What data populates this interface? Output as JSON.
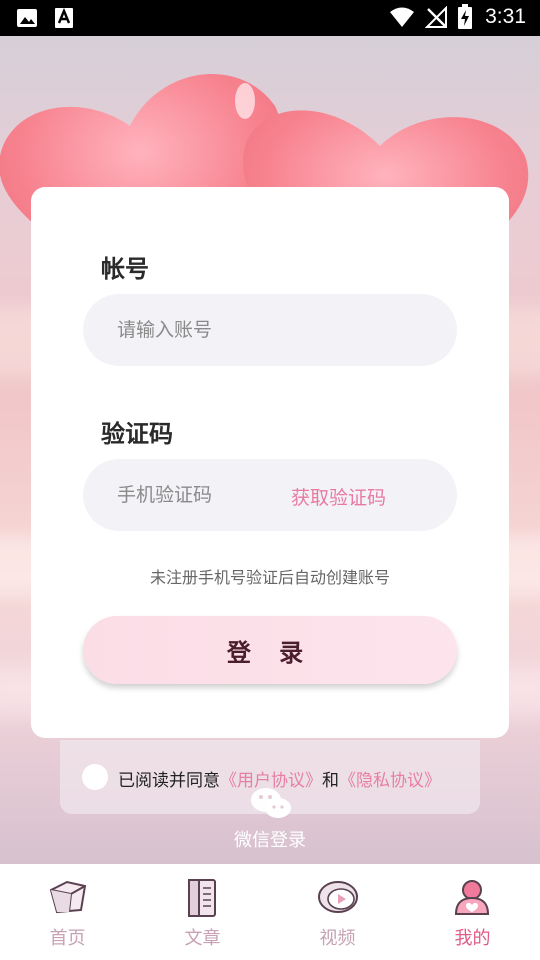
{
  "status_bar": {
    "time": "3:31",
    "left_icons": [
      "image-icon",
      "font-a-icon"
    ],
    "right_icons": [
      "wifi-icon",
      "no-signal-icon",
      "battery-charging-icon"
    ]
  },
  "login": {
    "account_label": "帐号",
    "account_placeholder": "请输入账号",
    "code_label": "验证码",
    "code_placeholder": "手机验证码",
    "get_code": "获取验证码",
    "hint": "未注册手机号验证后自动创建账号",
    "login_button": "登  录"
  },
  "agreement": {
    "prefix": "已阅读并同意",
    "user_agreement": "《用户协议》",
    "and": "和",
    "privacy_agreement": "《隐私协议》"
  },
  "wechat": {
    "label": "微信登录"
  },
  "tabs": [
    {
      "label": "首页",
      "icon": "home-box-icon",
      "active": false
    },
    {
      "label": "文章",
      "icon": "article-book-icon",
      "active": false
    },
    {
      "label": "视频",
      "icon": "video-play-icon",
      "active": false
    },
    {
      "label": "我的",
      "icon": "profile-user-icon",
      "active": true
    }
  ],
  "colors": {
    "accent": "#e87aa0",
    "tab_active": "#e05b88",
    "tab_inactive": "#c6a2b4",
    "login_button": "#fbdde6"
  }
}
